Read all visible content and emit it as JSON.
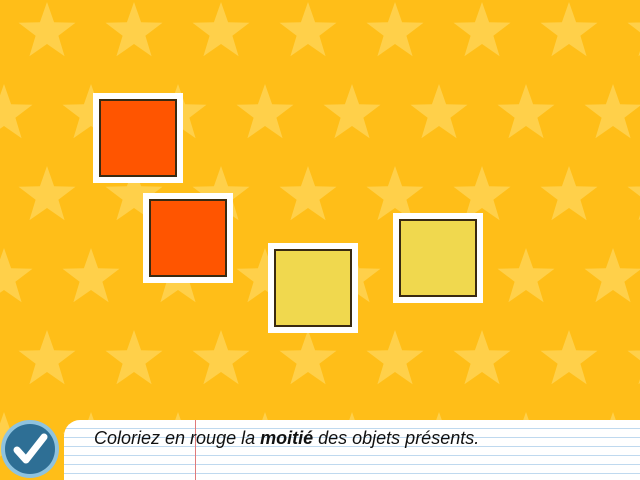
{
  "app": {
    "background_color": "#FFBE18",
    "star_color": "#FFD04A"
  },
  "tiles": [
    {
      "color": "#FF5500",
      "state": "red"
    },
    {
      "color": "#FF5500",
      "state": "red"
    },
    {
      "color": "#F0D84E",
      "state": "yellow"
    },
    {
      "color": "#F0D84E",
      "state": "yellow"
    }
  ],
  "instruction": {
    "prefix": "Coloriez en rouge la ",
    "emphasis": "moitié",
    "suffix": " des objets présents."
  },
  "validate_button": {
    "icon": "checkmark-icon",
    "color": "#2E6F95"
  }
}
